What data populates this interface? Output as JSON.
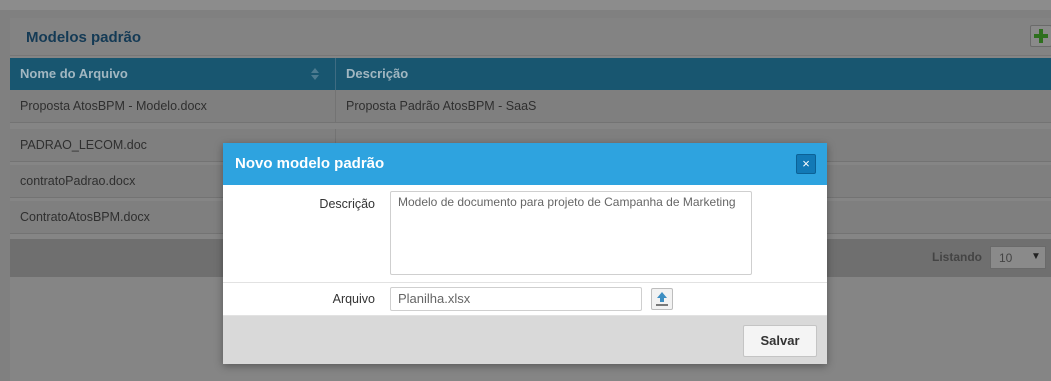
{
  "panel": {
    "title": "Modelos padrão",
    "add_icon": "plus-icon"
  },
  "table": {
    "columns": [
      "Nome do Arquivo",
      "Descrição"
    ],
    "rows": [
      {
        "file": "Proposta AtosBPM - Modelo.docx",
        "description": "Proposta Padrão AtosBPM - SaaS"
      },
      {
        "file": "PADRAO_LECOM.doc",
        "description": ""
      },
      {
        "file": "contratoPadrao.docx",
        "description": ""
      },
      {
        "file": "ContratoAtosBPM.docx",
        "description": ""
      }
    ],
    "footer": {
      "listing_label": "Listando",
      "page_size": "10"
    }
  },
  "modal": {
    "title": "Novo modelo padrão",
    "close_glyph": "×",
    "descricao_label": "Descrição",
    "descricao_value": "Modelo de documento para projeto de Campanha de Marketing",
    "arquivo_label": "Arquivo",
    "arquivo_value": "Planilha.xlsx",
    "upload_icon": "upload-icon",
    "save_label": "Salvar"
  },
  "colors": {
    "modal_header": "#2ea3df",
    "table_header": "#185670",
    "accent_green": "#3b9a2a"
  }
}
